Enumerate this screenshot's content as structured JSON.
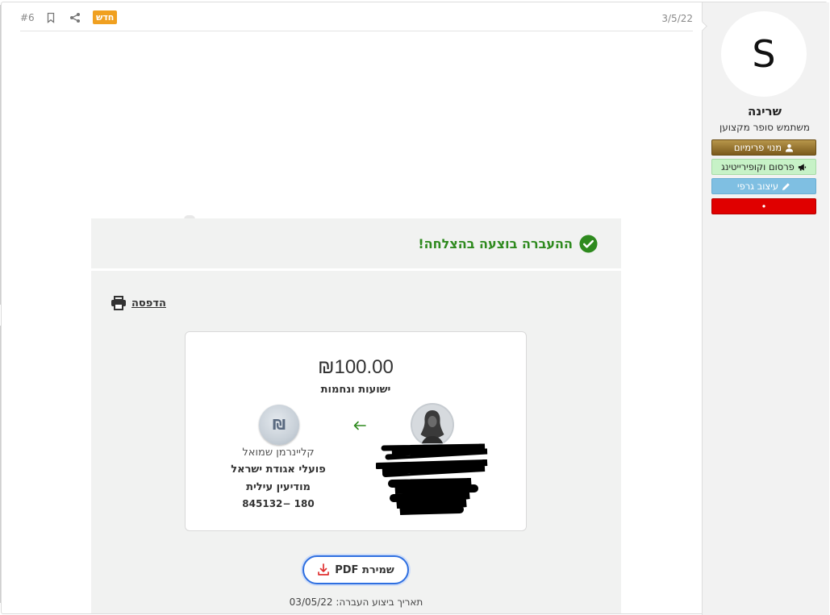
{
  "sidebar": {
    "avatar_letter": "S",
    "username": "שרינה",
    "user_title": "משתמש סופר מקצוען",
    "badges": {
      "premium": "מנוי פרימיום",
      "ads": "פרסום וקופירייטינג",
      "design": "עיצוב גרפי",
      "red": "•"
    }
  },
  "post": {
    "date": "3/5/22",
    "new_label": "חדש",
    "number": "#6"
  },
  "transfer": {
    "success_message": "ההעברה בוצעה בהצלחה!",
    "print_label": "הדפסה",
    "amount": "₪100.00",
    "recipient_name": "ישועות ונחמות",
    "receiver": {
      "line1": "קליינרמן שמואל",
      "line2": "פועלי אגודת ישראל",
      "line3": "מודיעין עילית",
      "line4": "180 −845132"
    },
    "pdf_label": "שמירת PDF",
    "date_line": "תאריך ביצוע העברה: 03/05/22"
  },
  "colors": {
    "success_green": "#2e8a1e",
    "new_badge": "#f0a020",
    "pdf_border": "#2e6fe0"
  }
}
